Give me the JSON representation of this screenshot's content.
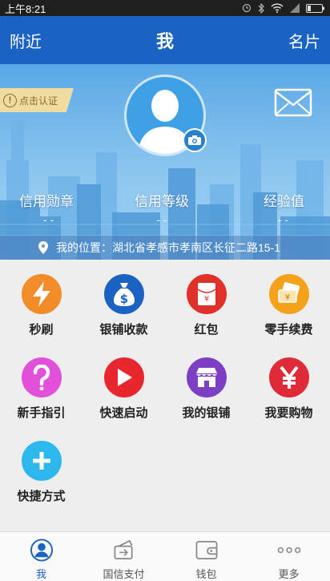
{
  "status": {
    "time": "上午8:21"
  },
  "appbar": {
    "left": "附近",
    "title": "我",
    "right": "名片"
  },
  "profile": {
    "certify_label": "点击认证",
    "stats": [
      {
        "label": "信用勋章",
        "value": "- -"
      },
      {
        "label": "信用等级",
        "value": "- -"
      },
      {
        "label": "经验值",
        "value": "- -"
      }
    ],
    "location": "我的位置：湖北省孝感市孝南区长征二路15-1"
  },
  "grid": {
    "items": [
      {
        "label": "秒刷",
        "icon": "lightning-icon",
        "color": "#f28c28"
      },
      {
        "label": "银铺收款",
        "icon": "money-bag-icon",
        "color": "#1a63c3"
      },
      {
        "label": "红包",
        "icon": "red-envelope-icon",
        "color": "#e0302a"
      },
      {
        "label": "零手续费",
        "icon": "card-icon",
        "color": "#f5a21b"
      },
      {
        "label": "新手指引",
        "icon": "question-icon",
        "color": "#e24fd8"
      },
      {
        "label": "快速启动",
        "icon": "play-icon",
        "color": "#e8262e"
      },
      {
        "label": "我的银铺",
        "icon": "shop-icon",
        "color": "#7d3fc4"
      },
      {
        "label": "我要购物",
        "icon": "yen-icon",
        "color": "#e02a37"
      },
      {
        "label": "快捷方式",
        "icon": "plus-icon",
        "color": "#2cb8ec"
      }
    ]
  },
  "tabbar": {
    "items": [
      {
        "label": "我",
        "icon": "person-icon"
      },
      {
        "label": "国信支付",
        "icon": "payment-icon"
      },
      {
        "label": "钱包",
        "icon": "wallet-icon"
      },
      {
        "label": "更多",
        "icon": "more-icon"
      }
    ]
  }
}
